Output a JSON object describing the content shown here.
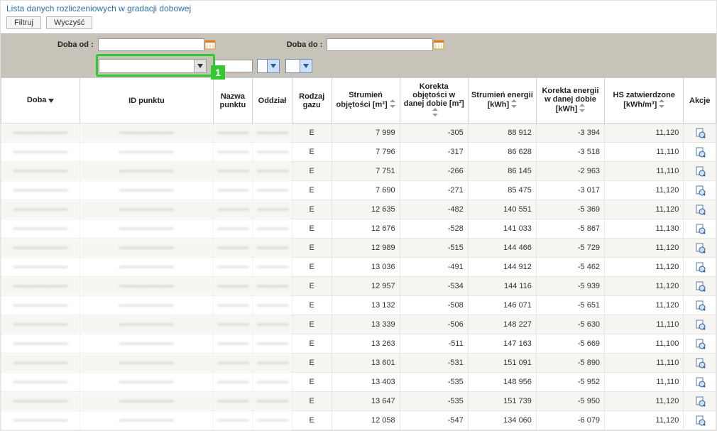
{
  "title": "Lista danych rozliczeniowych w gradacji dobowej",
  "buttons": {
    "filter": "Filtruj",
    "clear": "Wyczyść"
  },
  "filters": {
    "from_label": "Doba od :",
    "to_label": "Doba do :",
    "from_value": "",
    "to_value": "",
    "dropdown_value": ""
  },
  "highlight": {
    "number": "1"
  },
  "columns": {
    "doba": "Doba",
    "id_punktu": "ID punktu",
    "nazwa_punktu": "Nazwa punktu",
    "oddzial": "Oddział",
    "rodzaj_gazu": "Rodzaj gazu",
    "strumien_obj": "Strumień objętości [m³]",
    "korekta_obj": "Korekta objętości w danej dobie [m³]",
    "strumien_en": "Strumień energii [kWh]",
    "korekta_en": "Korekta energii w danej dobie [kWh]",
    "hs": "HS zatwierdzone [kWh/m³]",
    "akcje": "Akcje"
  },
  "rows": [
    {
      "rg": "E",
      "so": "7 999",
      "ko": "-305",
      "se": "88 912",
      "ke": "-3 394",
      "hs": "11,120"
    },
    {
      "rg": "E",
      "so": "7 796",
      "ko": "-317",
      "se": "86 628",
      "ke": "-3 518",
      "hs": "11,110"
    },
    {
      "rg": "E",
      "so": "7 751",
      "ko": "-266",
      "se": "86 145",
      "ke": "-2 963",
      "hs": "11,110"
    },
    {
      "rg": "E",
      "so": "7 690",
      "ko": "-271",
      "se": "85 475",
      "ke": "-3 017",
      "hs": "11,120"
    },
    {
      "rg": "E",
      "so": "12 635",
      "ko": "-482",
      "se": "140 551",
      "ke": "-5 369",
      "hs": "11,120"
    },
    {
      "rg": "E",
      "so": "12 676",
      "ko": "-528",
      "se": "141 033",
      "ke": "-5 867",
      "hs": "11,130"
    },
    {
      "rg": "E",
      "so": "12 989",
      "ko": "-515",
      "se": "144 466",
      "ke": "-5 729",
      "hs": "11,120"
    },
    {
      "rg": "E",
      "so": "13 036",
      "ko": "-491",
      "se": "144 912",
      "ke": "-5 462",
      "hs": "11,120"
    },
    {
      "rg": "E",
      "so": "12 957",
      "ko": "-534",
      "se": "144 116",
      "ke": "-5 939",
      "hs": "11,120"
    },
    {
      "rg": "E",
      "so": "13 132",
      "ko": "-508",
      "se": "146 071",
      "ke": "-5 651",
      "hs": "11,120"
    },
    {
      "rg": "E",
      "so": "13 339",
      "ko": "-506",
      "se": "148 227",
      "ke": "-5 630",
      "hs": "11,110"
    },
    {
      "rg": "E",
      "so": "13 263",
      "ko": "-511",
      "se": "147 163",
      "ke": "-5 669",
      "hs": "11,100"
    },
    {
      "rg": "E",
      "so": "13 601",
      "ko": "-531",
      "se": "151 091",
      "ke": "-5 890",
      "hs": "11,110"
    },
    {
      "rg": "E",
      "so": "13 403",
      "ko": "-535",
      "se": "148 956",
      "ke": "-5 952",
      "hs": "11,110"
    },
    {
      "rg": "E",
      "so": "13 647",
      "ko": "-535",
      "se": "151 739",
      "ke": "-5 950",
      "hs": "11,120"
    },
    {
      "rg": "E",
      "so": "12 058",
      "ko": "-547",
      "se": "134 060",
      "ke": "-6 079",
      "hs": "11,120"
    }
  ]
}
